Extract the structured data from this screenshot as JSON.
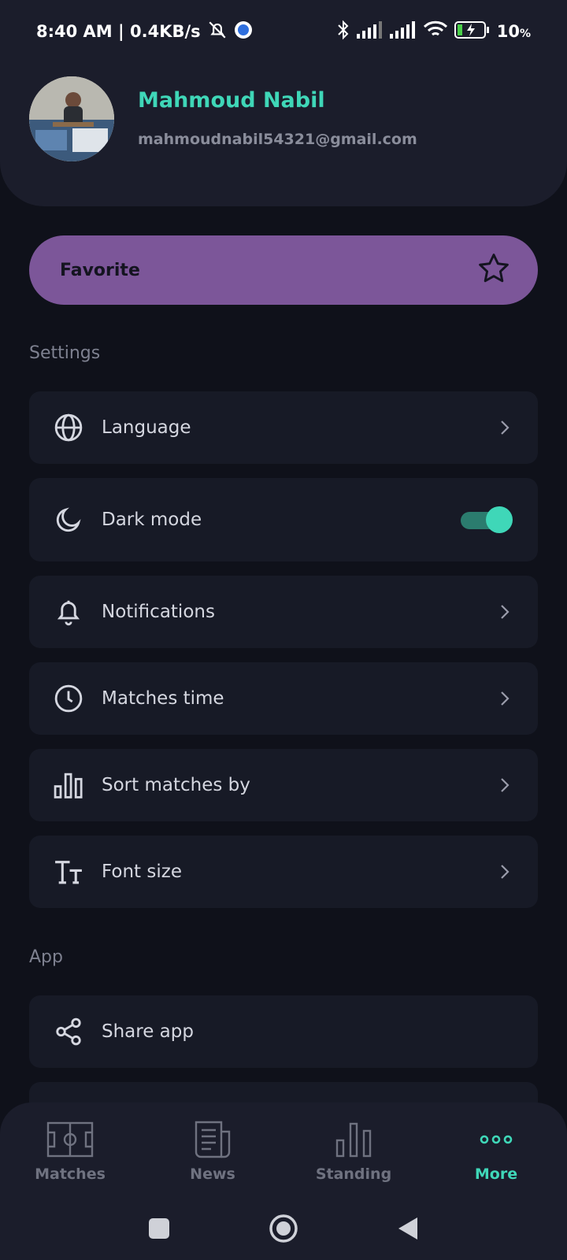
{
  "status": {
    "time_speed": "8:40 AM | 0.4KB/s",
    "battery": "10",
    "battery_unit": "%"
  },
  "profile": {
    "name": "Mahmoud Nabil",
    "email": "mahmoudnabil54321@gmail.com"
  },
  "favorite": {
    "label": "Favorite",
    "icon": "star-icon"
  },
  "settings": {
    "title": "Settings",
    "items": [
      {
        "label": "Language",
        "icon": "globe-icon"
      },
      {
        "label": "Dark mode",
        "icon": "moon-icon",
        "toggle_on": true
      },
      {
        "label": "Notifications",
        "icon": "bell-icon"
      },
      {
        "label": "Matches time",
        "icon": "clock-icon"
      },
      {
        "label": "Sort matches by",
        "icon": "bar-chart-icon"
      },
      {
        "label": "Font size",
        "icon": "text-size-icon"
      }
    ]
  },
  "app": {
    "title": "App",
    "items": [
      {
        "label": "Share app",
        "icon": "share-icon"
      }
    ]
  },
  "nav": {
    "items": [
      {
        "label": "Matches",
        "icon": "pitch-icon",
        "active": false
      },
      {
        "label": "News",
        "icon": "newspaper-icon",
        "active": false
      },
      {
        "label": "Standing",
        "icon": "bar-chart-icon",
        "active": false
      },
      {
        "label": "More",
        "icon": "more-dots-icon",
        "active": true
      }
    ]
  },
  "colors": {
    "accent": "#3fd7b8",
    "favorite_bg": "#7c5699",
    "background": "#0f111a",
    "card": "#171a26"
  }
}
